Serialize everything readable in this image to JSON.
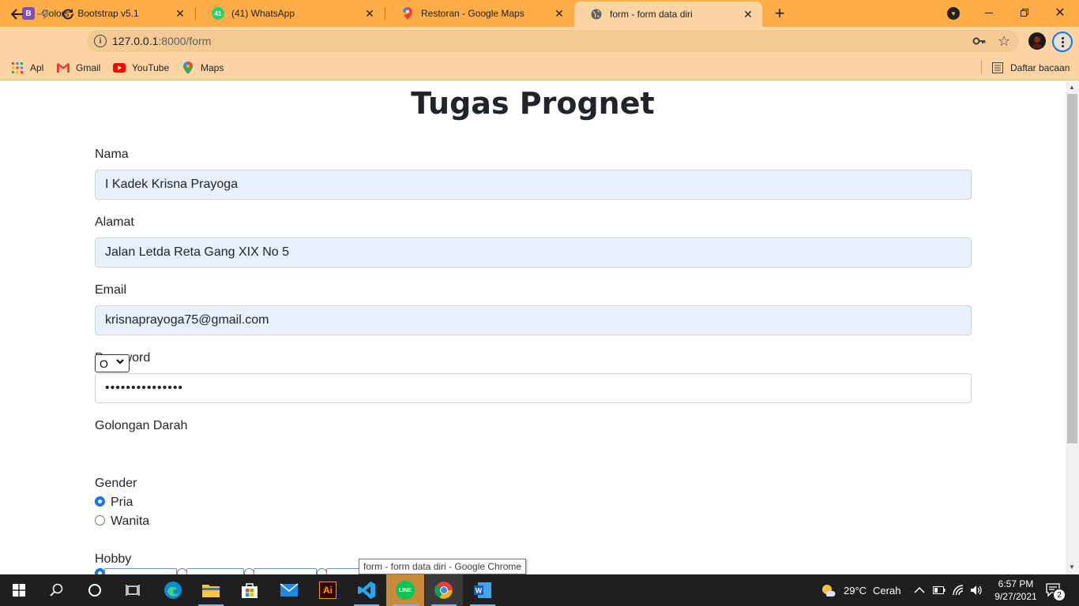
{
  "browser": {
    "tabs": [
      {
        "title": "Colors · Bootstrap v5.1",
        "favicon_letter": "B",
        "favicon_color": "#7952b3"
      },
      {
        "title": "(41) WhatsApp",
        "favicon_letter": "41",
        "favicon_color": "#25d366"
      },
      {
        "title": "Restoran - Google Maps",
        "favicon_letter": "",
        "favicon_color": "#ea4335"
      },
      {
        "title": "form - form data diri",
        "favicon_letter": "",
        "favicon_color": "#5f6368"
      }
    ],
    "new_tab_label": "+",
    "close_glyph": "✕",
    "url_host": "127.0.0.1",
    "url_path": ":8000/form",
    "bookmarks": [
      {
        "label": "Apl",
        "icon": "apps-grid-icon"
      },
      {
        "label": "Gmail",
        "icon": "gmail-icon"
      },
      {
        "label": "YouTube",
        "icon": "youtube-icon"
      },
      {
        "label": "Maps",
        "icon": "maps-icon"
      }
    ],
    "reading_list": "Daftar bacaan"
  },
  "page": {
    "heading": "Tugas Prognet",
    "nama_label": "Nama",
    "nama_value": "I Kadek Krisna Prayoga",
    "alamat_label": "Alamat",
    "alamat_value": "Jalan Letda Reta Gang XIX No 5",
    "email_label": "Email",
    "email_value": "krisnaprayoga75@gmail.com",
    "password_label": "Password",
    "password_value": "•••••••••••••••",
    "golongan_label": "Golongan Darah",
    "golongan_value": "O",
    "gender_label": "Gender",
    "gender_options": [
      "Pria",
      "Wanita"
    ],
    "gender_selected": "Pria",
    "hobby_label": "Hobby"
  },
  "tooltip": "form - form data diri - Google Chrome",
  "taskbar": {
    "weather_temp": "29°C",
    "weather_desc": "Cerah",
    "time": "6:57 PM",
    "date": "9/27/2021",
    "notif_count": "2"
  },
  "colors": {
    "tab_strip": "#ffad48",
    "toolbar": "#fdd5a4",
    "autofill_bg": "#e8f0fe",
    "radio_accent": "#1a73e8"
  }
}
